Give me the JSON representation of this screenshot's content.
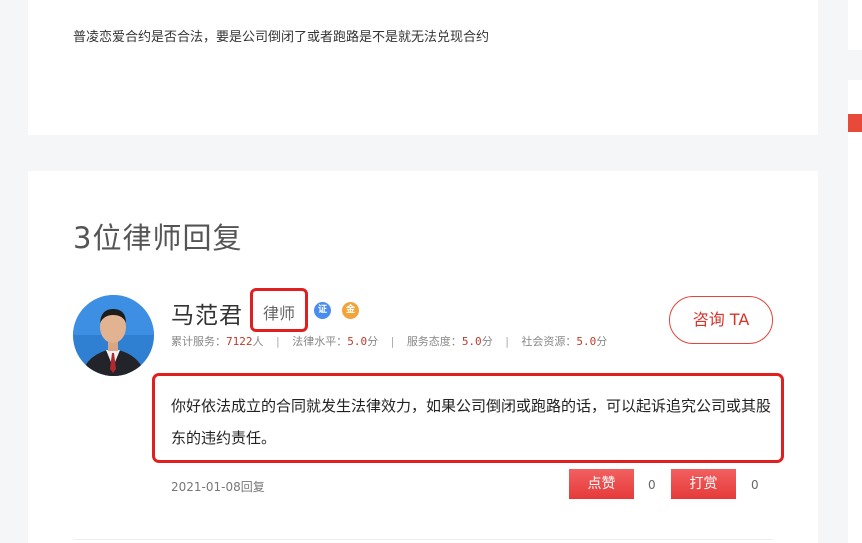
{
  "question": {
    "text": "普凌恋爱合约是否合法，要是公司倒闭了或者跑路是不是就无法兑现合约"
  },
  "answers_section": {
    "title": "3位律师回复"
  },
  "answer": {
    "lawyer_name": "马范君",
    "role": "律师",
    "badge_cert": "证",
    "badge_level": "金",
    "stats": [
      {
        "label": "累计服务：",
        "value": "7122",
        "unit": "人"
      },
      {
        "label": "法律水平：",
        "value": "5.0",
        "unit": "分"
      },
      {
        "label": "服务态度：",
        "value": "5.0",
        "unit": "分"
      },
      {
        "label": "社会资源：",
        "value": "5.0",
        "unit": "分"
      }
    ],
    "separator": "|",
    "consult_label": "咨询 TA",
    "content": "你好依法成立的合同就发生法律效力，如果公司倒闭或跑路的话，可以起诉追究公司或其股东的违约责任。",
    "date": "2021-01-08回复",
    "like_label": "点赞",
    "like_count": "0",
    "reward_label": "打赏",
    "reward_count": "0"
  },
  "colors": {
    "accent_red": "#e02020",
    "button_red": "#e63a3a",
    "stat_value": "#c23a2a",
    "badge_blue": "#4a8cf0",
    "badge_orange": "#f2a33a"
  }
}
